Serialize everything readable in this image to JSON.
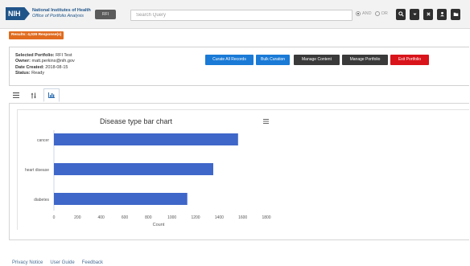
{
  "header": {
    "logo_text": "NIH",
    "org_name_line1": "National Institutes of Health",
    "org_name_line2": "Office of Portfolio Analysis",
    "app_badge": "RFI",
    "search_placeholder": "Search Query",
    "and_label": "AND",
    "or_label": "OR",
    "toolbar_icons": [
      "search-icon",
      "chevron-down-icon",
      "close-icon",
      "user-icon",
      "folder-icon"
    ]
  },
  "results_badge": "Results: 4,039 Response(s)",
  "portfolio": {
    "selected_label": "Selected Portfolio:",
    "selected_value": "RFI Test",
    "owner_label": "Owner:",
    "owner_value": "matt.perkins@nih.gov",
    "date_label": "Date Created:",
    "date_value": "2018-08-15",
    "status_label": "Status:",
    "status_value": "Ready"
  },
  "actions": {
    "curate_all": "Curate All Records",
    "bulk_curation": "Bulk Curation",
    "manage_content": "Manage Content",
    "manage_portfolio": "Manage Portfolio",
    "exit_portfolio": "Exit Portfolio"
  },
  "colors": {
    "primary_blue": "#1a7ad6",
    "dark": "#3a3a3a",
    "danger": "#d9141b",
    "results_orange": "#e06b1e",
    "bar_blue": "#3f67c9"
  },
  "view_tabs": [
    "list-icon",
    "sort-icon",
    "bar-chart-icon"
  ],
  "chart_data": {
    "type": "bar",
    "orientation": "horizontal",
    "title": "Disease type bar chart",
    "categories": [
      "cancer",
      "heart disease",
      "diabetes"
    ],
    "values": [
      1560,
      1350,
      1130
    ],
    "xlabel": "Count",
    "ylabel": "",
    "xlim": [
      0,
      1800
    ],
    "xticks": [
      0,
      200,
      400,
      600,
      800,
      1000,
      1200,
      1400,
      1600,
      1800
    ],
    "grid": false,
    "legend": "none"
  },
  "footer": {
    "privacy": "Privacy Notice",
    "guide": "User Guide",
    "feedback": "Feedback"
  }
}
